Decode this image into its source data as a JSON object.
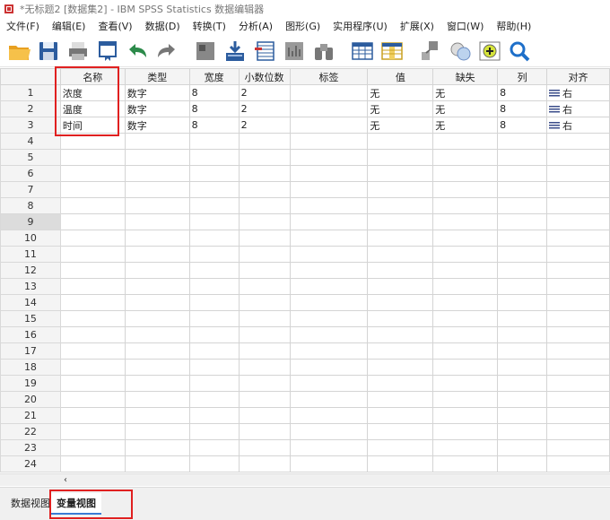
{
  "window": {
    "title": "*无标题2 [数据集2] - IBM SPSS Statistics 数据编辑器"
  },
  "menu": [
    {
      "label": "文件(F)"
    },
    {
      "label": "编辑(E)"
    },
    {
      "label": "查看(V)"
    },
    {
      "label": "数据(D)"
    },
    {
      "label": "转换(T)"
    },
    {
      "label": "分析(A)"
    },
    {
      "label": "图形(G)"
    },
    {
      "label": "实用程序(U)"
    },
    {
      "label": "扩展(X)"
    },
    {
      "label": "窗口(W)"
    },
    {
      "label": "帮助(H)"
    }
  ],
  "toolbar": [
    "open-folder-icon",
    "save-disk-icon",
    "print-icon",
    "recall-dialog-icon",
    "undo-icon",
    "redo-icon",
    "goto-case-icon",
    "goto-variable-icon",
    "variables-icon",
    "run-descriptive-icon",
    "find-binoculars-icon",
    "insert-cases-icon",
    "insert-variable-icon",
    "split-file-icon",
    "weight-cases-icon",
    "select-cases-icon",
    "search-magnifier-icon"
  ],
  "grid": {
    "columns": [
      "名称",
      "类型",
      "宽度",
      "小数位数",
      "标签",
      "值",
      "缺失",
      "列",
      "对齐"
    ],
    "row_numbers": [
      "1",
      "2",
      "3",
      "4",
      "5",
      "6",
      "7",
      "8",
      "9",
      "10",
      "11",
      "12",
      "13",
      "14",
      "15",
      "16",
      "17",
      "18",
      "19",
      "20",
      "21",
      "22",
      "23",
      "24"
    ],
    "rows": [
      [
        "浓度",
        "数字",
        "8",
        "2",
        "",
        "无",
        "无",
        "8",
        "右"
      ],
      [
        "温度",
        "数字",
        "8",
        "2",
        "",
        "无",
        "无",
        "8",
        "右"
      ],
      [
        "时间",
        "数字",
        "8",
        "2",
        "",
        "无",
        "无",
        "8",
        "右"
      ]
    ],
    "selected_row": "9"
  },
  "tabs": {
    "data_view": "数据视图",
    "variable_view": "变量视图"
  },
  "colors": {
    "highlight_box": "#e02020",
    "accent": "#3a7bd5"
  }
}
